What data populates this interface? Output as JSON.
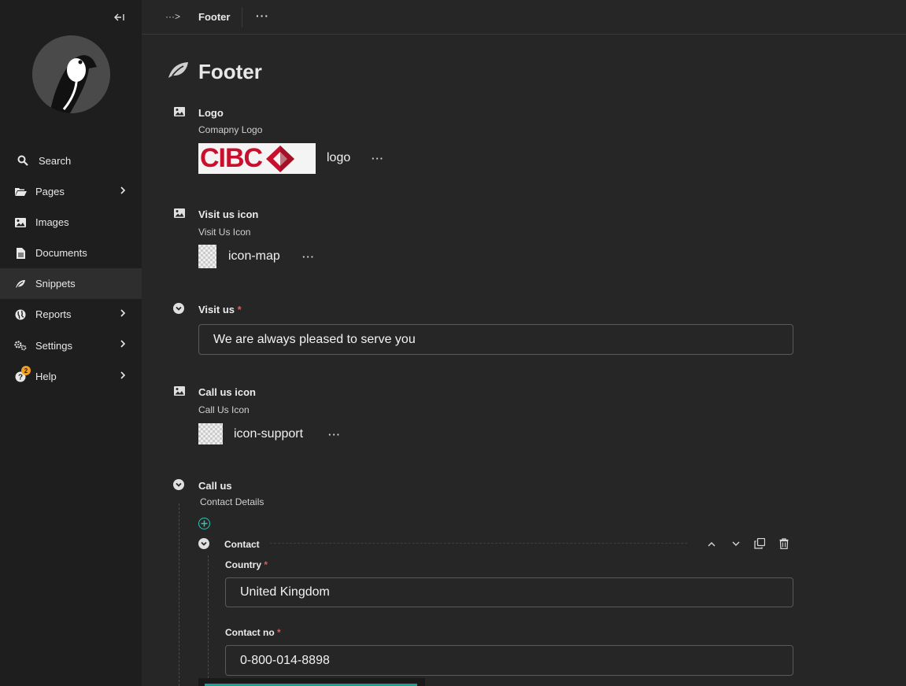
{
  "sidebar": {
    "collapse_icon": "collapse-left-icon",
    "items": [
      {
        "label": "Search",
        "icon": "search-icon"
      },
      {
        "label": "Pages",
        "icon": "folder-open-icon",
        "has_submenu": true
      },
      {
        "label": "Images",
        "icon": "image-icon"
      },
      {
        "label": "Documents",
        "icon": "doc-icon"
      },
      {
        "label": "Snippets",
        "icon": "snippet-icon",
        "active": true
      },
      {
        "label": "Reports",
        "icon": "globe-icon",
        "has_submenu": true
      },
      {
        "label": "Settings",
        "icon": "cogs-icon",
        "has_submenu": true
      },
      {
        "label": "Help",
        "icon": "help-icon",
        "has_submenu": true,
        "badge": "2"
      }
    ]
  },
  "header": {
    "breadcrumb_toggle": "···>",
    "title": "Footer",
    "more": "···"
  },
  "page": {
    "title": "Footer"
  },
  "fields": {
    "logo": {
      "label": "Logo",
      "help": "Comapny Logo",
      "image_name": "logo",
      "image_text": "CIBC",
      "more": "···"
    },
    "visit_icon": {
      "label": "Visit us icon",
      "help": "Visit Us Icon",
      "image_name": "icon-map",
      "more": "···"
    },
    "visit_us": {
      "label": "Visit us",
      "required": "*",
      "value": "We are always pleased to serve you"
    },
    "call_icon": {
      "label": "Call us icon",
      "help": "Call Us Icon",
      "image_name": "icon-support",
      "more": "···"
    },
    "call_us": {
      "label": "Call us",
      "help": "Contact Details",
      "block": {
        "label": "Contact",
        "country": {
          "label": "Country",
          "required": "*",
          "value": "United Kingdom"
        },
        "contact_no": {
          "label": "Contact no",
          "required": "*",
          "value": "0-800-014-8898"
        }
      }
    }
  },
  "colors": {
    "accent": "#2ec4b6",
    "required": "#e05a5a",
    "brand_logo": "#c8102e",
    "badge": "#f0a020"
  }
}
